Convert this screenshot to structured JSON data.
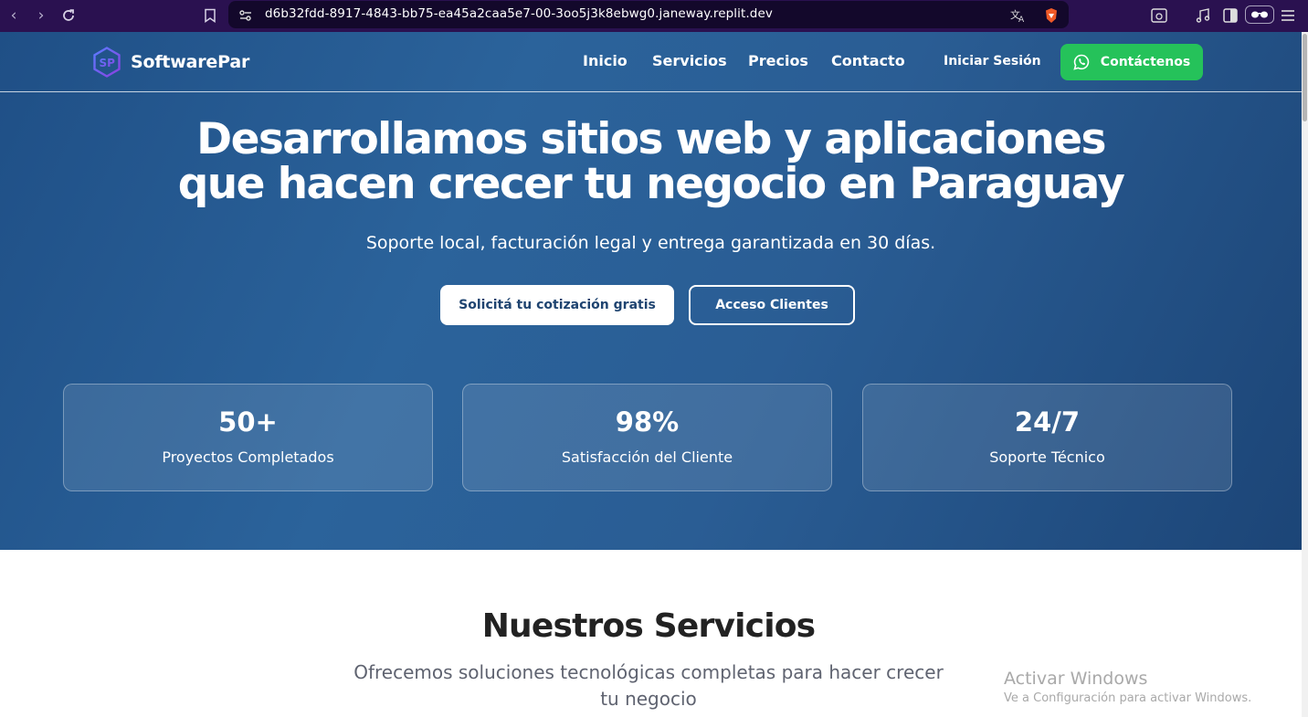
{
  "browser": {
    "url": "d6b32fdd-8917-4843-bb75-ea45a2caa5e7-00-3oo5j3k8ebwg0.janeway.replit.dev"
  },
  "header": {
    "brand": "SoftwarePar",
    "nav": [
      "Inicio",
      "Servicios",
      "Precios",
      "Contacto"
    ],
    "login": "Iniciar Sesión",
    "cta": "Contáctenos"
  },
  "hero": {
    "title_line1": "Desarrollamos sitios web y aplicaciones",
    "title_line2": "que hacen crecer tu negocio en Paraguay",
    "subtitle": "Soporte local, facturación legal y entrega garantizada en 30 días.",
    "primary_button": "Solicitá tu cotización gratis",
    "secondary_button": "Acceso Clientes"
  },
  "stats": [
    {
      "value": "50+",
      "label": "Proyectos Completados"
    },
    {
      "value": "98%",
      "label": "Satisfacción del Cliente"
    },
    {
      "value": "24/7",
      "label": "Soporte Técnico"
    }
  ],
  "services": {
    "title": "Nuestros Servicios",
    "subtitle_line1": "Ofrecemos soluciones tecnológicas completas para hacer crecer",
    "subtitle_line2": "tu negocio"
  },
  "watermark": {
    "line1": "Activar Windows",
    "line2": "Ve a Configuración para activar Windows."
  },
  "colors": {
    "hero_bg": "#2b639b",
    "whatsapp_green": "#25c25a",
    "browser_chrome": "#2a1150"
  }
}
